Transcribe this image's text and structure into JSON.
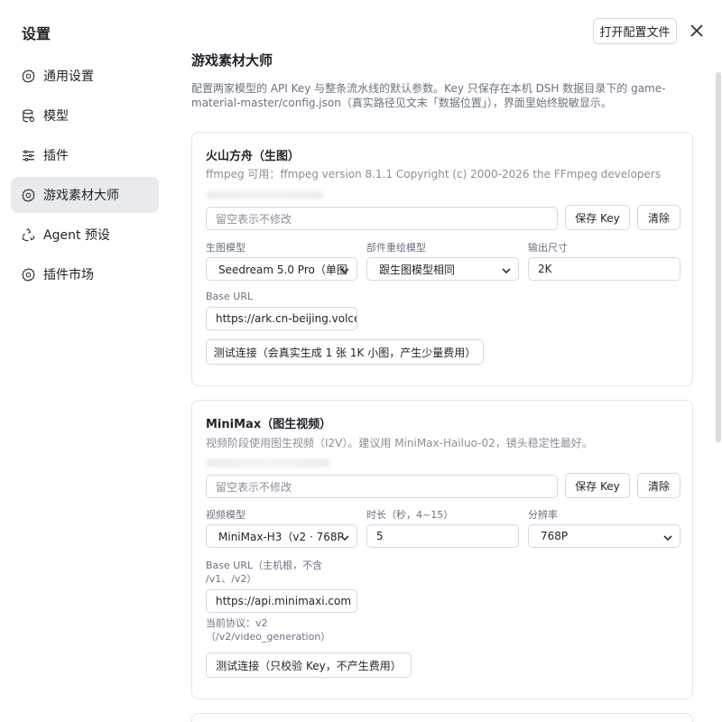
{
  "sidebar": {
    "title": "设置",
    "items": [
      {
        "label": "通用设置",
        "icon": "gear-icon"
      },
      {
        "label": "模型",
        "icon": "database-icon"
      },
      {
        "label": "插件",
        "icon": "sliders-icon"
      },
      {
        "label": "游戏素材大师",
        "icon": "gear-icon",
        "active": true
      },
      {
        "label": "Agent 预设",
        "icon": "recycle-icon"
      },
      {
        "label": "插件市场",
        "icon": "gear-icon"
      }
    ]
  },
  "header": {
    "open_config_label": "打开配置文件",
    "close_icon": "close-icon"
  },
  "main": {
    "title": "游戏素材大师",
    "description": "配置两家模型的 API Key 与整条流水线的默认参数。Key 只保存在本机 DSH 数据目录下的 game-material-master/config.json（真实路径见文末「数据位置」），界面里始终脱敏显示。"
  },
  "volcano": {
    "title": "火山方舟（生图）",
    "subtitle": "ffmpeg 可用：ffmpeg version 8.1.1 Copyright (c) 2000-2026 the FFmpeg developers",
    "key_placeholder": "留空表示不修改",
    "save_key_label": "保存 Key",
    "clear_label": "清除",
    "image_model_label": "生图模型",
    "image_model_value": "Seedream 5.0 Pro（单图",
    "repaint_model_label": "部件重绘模型",
    "repaint_model_value": "跟生图模型相同",
    "output_size_label": "输出尺寸",
    "output_size_value": "2K",
    "base_url_label": "Base URL",
    "base_url_value": "https://ark.cn-beijing.volces.com",
    "test_button_label": "测试连接（会真实生成 1 张 1K 小图，产生少量费用）"
  },
  "minimax": {
    "title": "MiniMax（图生视频）",
    "subtitle": "视频阶段使用图生视频（I2V）。建议用 MiniMax-Hailuo-02，镜头稳定性最好。",
    "key_placeholder": "留空表示不修改",
    "save_key_label": "保存 Key",
    "clear_label": "清除",
    "video_model_label": "视频模型",
    "video_model_value": "MiniMax-H3（v2 · 768P",
    "duration_label": "时长（秒，4~15）",
    "duration_value": "5",
    "resolution_label": "分辨率",
    "resolution_value": "768P",
    "base_url_label_line1": "Base URL（主机根，不含",
    "base_url_label_line2": "/v1、/v2）",
    "base_url_value": "https://api.minimaxi.com",
    "protocol_hint_line1": "当前协议：v2",
    "protocol_hint_line2": "（/v2/video_generation）",
    "test_button_label": "测试连接（只校验 Key，不产生费用）"
  }
}
